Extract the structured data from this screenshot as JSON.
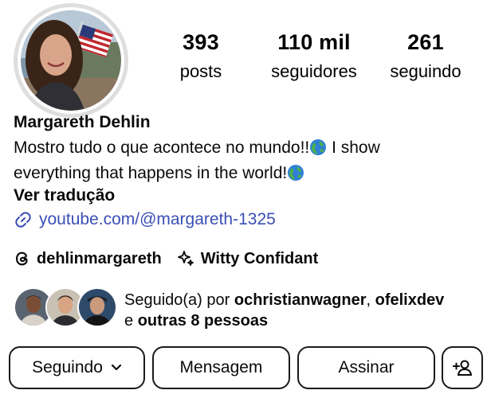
{
  "profile": {
    "name": "Margareth Dehlin",
    "bio_line1": "Mostro tudo o que acontece no mundo!!",
    "bio_line1b": " I show",
    "bio_line2": "everything that happens in the world!",
    "translate_label": "Ver tradução",
    "link": "youtube.com/@margareth-1325",
    "threads_handle": "dehlinmargareth",
    "badge_label": "Witty Confidant"
  },
  "stats": {
    "posts_count": "393",
    "posts_label": "posts",
    "followers_count": "110 mil",
    "followers_label": "seguidores",
    "following_count": "261",
    "following_label": "seguindo"
  },
  "followed_by": {
    "prefix": "Seguido(a) por ",
    "user1": "ochristianwagner",
    "separator": ", ",
    "user2": "ofelixdev",
    "connector": "e ",
    "others": "outras 8 pessoas"
  },
  "actions": {
    "following_label": "Seguindo",
    "message_label": "Mensagem",
    "subscribe_label": "Assinar"
  },
  "icons": {
    "link": "link-icon",
    "threads": "threads-icon",
    "badge": "sparkle-icon",
    "chevron": "chevron-down-icon",
    "add_user": "add-user-icon",
    "globe": "globe-emoji"
  },
  "colors": {
    "link": "#3a4fb4",
    "border": "#1a1a1a",
    "text": "#0a0a0a"
  }
}
